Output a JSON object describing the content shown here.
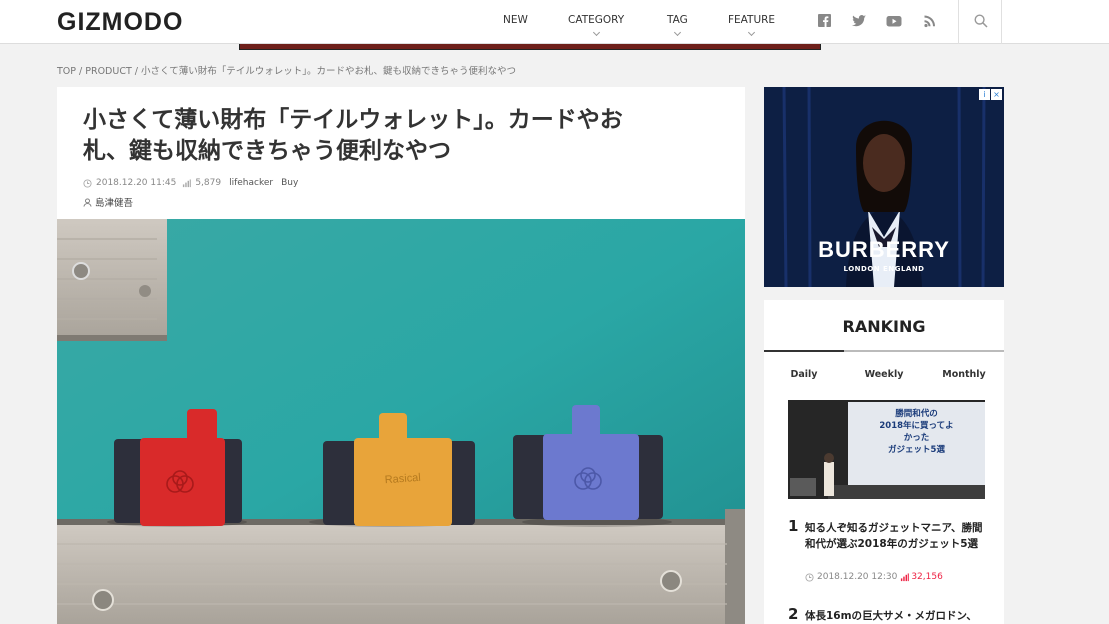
{
  "header": {
    "logo": "GIZMODO",
    "nav": [
      {
        "label": "NEW",
        "has_dropdown": false
      },
      {
        "label": "CATEGORY",
        "has_dropdown": true
      },
      {
        "label": "TAG",
        "has_dropdown": true
      },
      {
        "label": "FEATURE",
        "has_dropdown": true
      }
    ],
    "social_icons": [
      "facebook-icon",
      "twitter-icon",
      "youtube-icon",
      "rss-icon"
    ],
    "search_icon": "search-icon"
  },
  "breadcrumb": "TOP / PRODUCT / 小さくて薄い財布「テイルウォレット」。カードやお札、鍵も収納できちゃう便利なやつ",
  "article": {
    "title_line1": "小さくて薄い財布「テイルウォレット」。カードやお",
    "title_line2": "札、鍵も収納できちゃう便利なやつ",
    "date": "2018.12.20 11:45",
    "views": "5,879",
    "source": "lifehacker",
    "category": "Buy",
    "author": "島津健吾",
    "hero_image": {
      "wallet_colors": [
        "#d92a2a",
        "#e8a43a",
        "#6c79cf"
      ],
      "wall_color": "#2aa7a5",
      "brand_mark": "Rasical"
    }
  },
  "ad": {
    "brand": "BURBERRY",
    "tagline": "LONDON ENGLAND",
    "badges": [
      "i",
      "×"
    ]
  },
  "ranking": {
    "title": "RANKING",
    "tabs": [
      "Daily",
      "Weekly",
      "Monthly"
    ],
    "active_tab": "Daily",
    "image_slide_text": [
      "勝間和代の",
      "2018年に買ってよ",
      "かった",
      "ガジェット5選"
    ],
    "items": [
      {
        "rank": "1",
        "title": "知る人ぞ知るガジェットマニア、勝間和代が選ぶ2018年のガジェット5選",
        "date": "2018.12.20 12:30",
        "views": "32,156"
      },
      {
        "rank": "2",
        "title": "体長16mの巨大サメ・メガロドン、"
      }
    ]
  }
}
